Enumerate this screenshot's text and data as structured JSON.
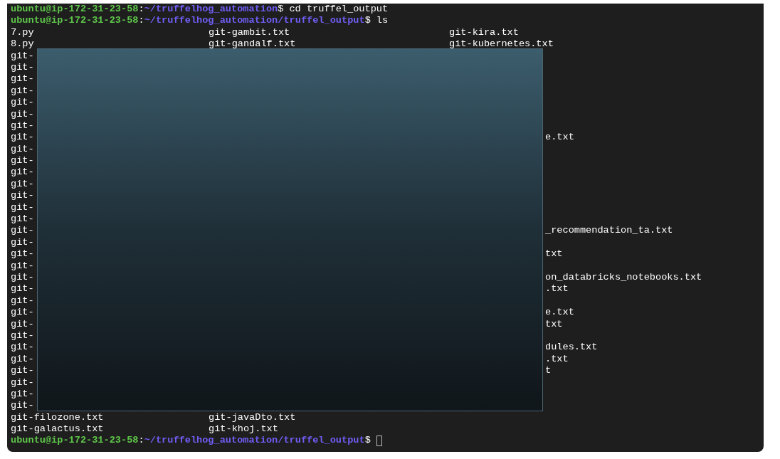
{
  "prompts_top": [
    {
      "user_host": "ubuntu@ip-172-31-23-58",
      "separator": ":",
      "path": "~/truffelhog_automation",
      "symbol": "$",
      "command": "cd truffel_output"
    },
    {
      "user_host": "ubuntu@ip-172-31-23-58",
      "separator": ":",
      "path": "~/truffelhog_automation/truffel_output",
      "symbol": "$",
      "command": "ls"
    }
  ],
  "listing": [
    {
      "col_1": "7.py",
      "col_2": "git-gambit.txt",
      "col_3": "git-kira.txt"
    },
    {
      "col_1": "8.py",
      "col_2": "git-gandalf.txt",
      "col_3": "git-kubernetes.txt"
    },
    {
      "col_1": "git-"
    },
    {
      "col_1": "git-"
    },
    {
      "col_1": "git-"
    },
    {
      "col_1": "git-"
    },
    {
      "col_1": "git-"
    },
    {
      "col_1": "git-"
    },
    {
      "col_1": "git-"
    },
    {
      "col_1": "git-",
      "fragment": "e.txt"
    },
    {
      "col_1": "git-"
    },
    {
      "col_1": "git-"
    },
    {
      "col_1": "git-"
    },
    {
      "col_1": "git-"
    },
    {
      "col_1": "git-"
    },
    {
      "col_1": "git-"
    },
    {
      "col_1": "git-"
    },
    {
      "col_1": "git-",
      "fragment": "_recommendation_ta.txt"
    },
    {
      "col_1": "git-"
    },
    {
      "col_1": "git-",
      "fragment": "txt"
    },
    {
      "col_1": "git-"
    },
    {
      "col_1": "git-",
      "fragment": "on_databricks_notebooks.txt"
    },
    {
      "col_1": "git-",
      "fragment": ".txt"
    },
    {
      "col_1": "git-"
    },
    {
      "col_1": "git-",
      "fragment": "e.txt"
    },
    {
      "col_1": "git-",
      "fragment": "txt"
    },
    {
      "col_1": "git-"
    },
    {
      "col_1": "git-",
      "fragment": "dules.txt"
    },
    {
      "col_1": "git-",
      "fragment": ".txt"
    },
    {
      "col_1": "git-",
      "fragment": "t"
    },
    {
      "col_1": "git-"
    },
    {
      "col_1": "git-"
    },
    {
      "col_1": "git-"
    },
    {
      "col_1": "git-filozone.txt",
      "col_2": "git-javaDto.txt"
    },
    {
      "col_1": "git-galactus.txt",
      "col_2": "git-khoj.txt"
    }
  ],
  "prompt_bottom": {
    "user_host": "ubuntu@ip-172-31-23-58",
    "separator": ":",
    "path": "~/truffelhog_automation/truffel_output",
    "symbol": "$",
    "cursor": true
  }
}
